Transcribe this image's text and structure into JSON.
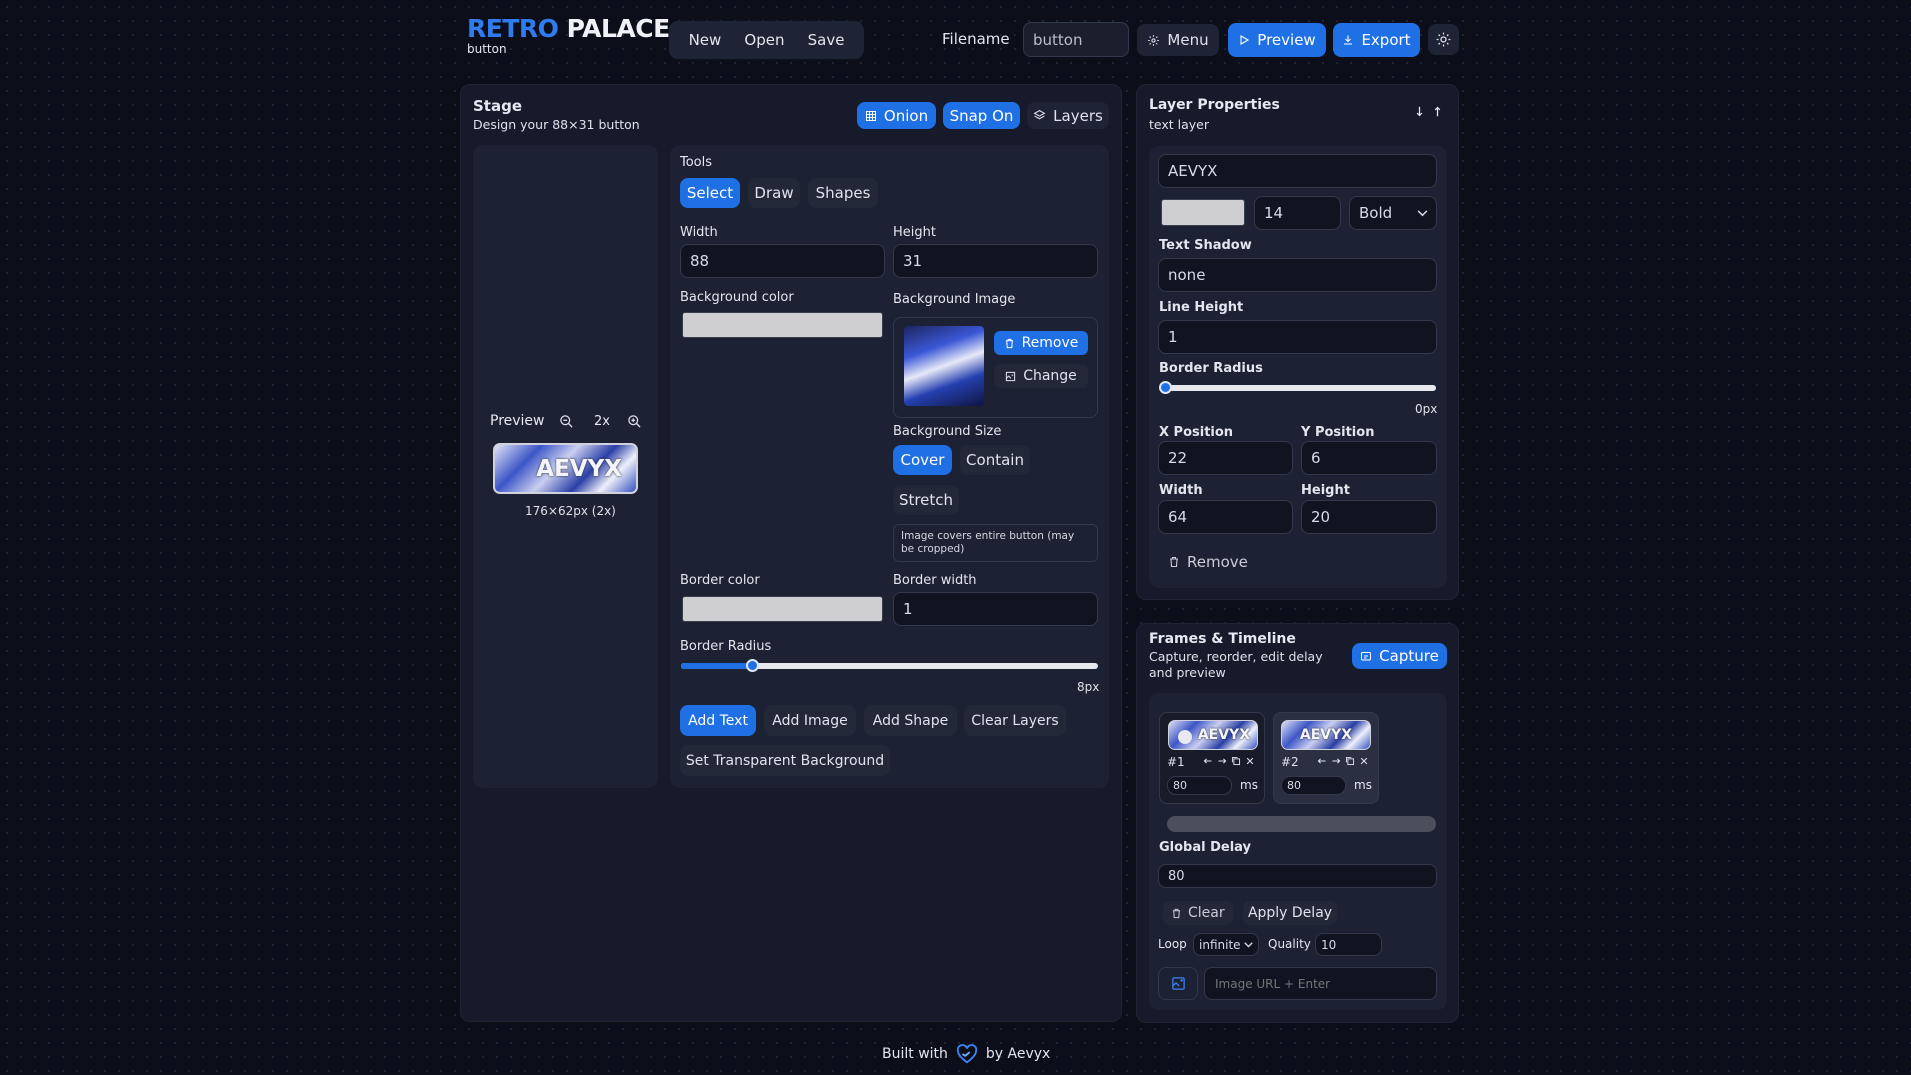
{
  "app": {
    "title_part1": "RETRO",
    "title_part2": "PALACE",
    "subtitle": "button"
  },
  "header": {
    "file_menu": [
      "New",
      "Open",
      "Save"
    ],
    "filename_label": "Filename",
    "filename_value": "button",
    "menu_label": "Menu",
    "preview_label": "Preview",
    "export_label": "Export"
  },
  "stage": {
    "title": "Stage",
    "subtitle": "Design your 88×31 button",
    "onion_label": "Onion",
    "snap_label": "Snap On",
    "layers_label": "Layers",
    "preview": {
      "label": "Preview",
      "zoom": "2x",
      "button_text": "AEVYX",
      "size_caption": "176×62px (2x)"
    },
    "tools": {
      "label": "Tools",
      "tabs": [
        "Select",
        "Draw",
        "Shapes"
      ],
      "width_label": "Width",
      "width_value": "88",
      "height_label": "Height",
      "height_value": "31",
      "bg_color_label": "Background color",
      "bg_image_label": "Background Image",
      "remove_label": "Remove",
      "change_label": "Change",
      "bg_size_label": "Background Size",
      "bg_size_options": [
        "Cover",
        "Contain",
        "Stretch"
      ],
      "bg_size_note": "Image covers entire button (may be cropped)",
      "border_color_label": "Border color",
      "border_width_label": "Border width",
      "border_width_value": "1",
      "border_radius_label": "Border Radius",
      "border_radius_value": "8px",
      "border_radius_fraction": 0.17,
      "actions": [
        "Add Text",
        "Add Image",
        "Add Shape",
        "Clear Layers"
      ],
      "transparent_label": "Set Transparent Background"
    }
  },
  "layer": {
    "title": "Layer Properties",
    "subtitle": "text layer",
    "text_value": "AEVYX",
    "font_size": "14",
    "font_weight": "Bold",
    "shadow_label": "Text Shadow",
    "shadow_value": "none",
    "line_height_label": "Line Height",
    "line_height_value": "1",
    "radius_label": "Border Radius",
    "radius_value": "0px",
    "x_label": "X Position",
    "x_value": "22",
    "y_label": "Y Position",
    "y_value": "6",
    "w_label": "Width",
    "w_value": "64",
    "h_label": "Height",
    "h_value": "20",
    "remove_label": "Remove"
  },
  "frames": {
    "title": "Frames & Timeline",
    "subtitle": "Capture, reorder, edit delay and preview",
    "capture_label": "Capture",
    "items": [
      {
        "num": "#1",
        "delay": "80",
        "unit": "ms",
        "text": "AEVYX"
      },
      {
        "num": "#2",
        "delay": "80",
        "unit": "ms",
        "text": "AEVYX"
      }
    ],
    "global_delay_label": "Global Delay",
    "global_delay_value": "80",
    "clear_label": "Clear",
    "apply_label": "Apply Delay",
    "loop_label": "Loop",
    "loop_value": "infinite",
    "quality_label": "Quality",
    "quality_value": "10",
    "url_placeholder": "Image URL + Enter"
  },
  "footer": {
    "built_with": "Built with",
    "by": "by Aevyx"
  },
  "colors": {
    "accent": "#1f6fe5",
    "background": "#0c0f1a",
    "panel": "#161a2b"
  }
}
